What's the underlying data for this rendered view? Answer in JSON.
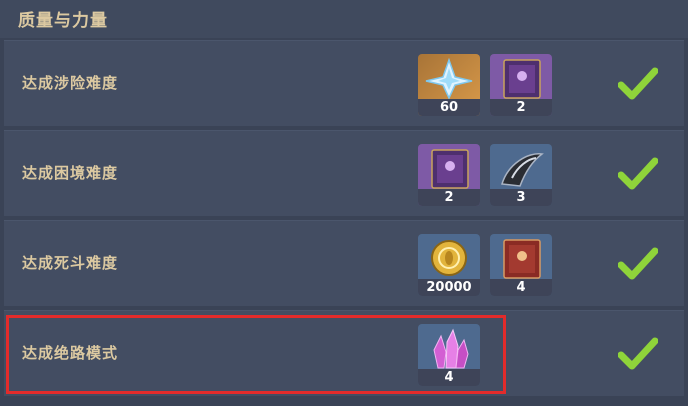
{
  "section": {
    "title": "质量与力量"
  },
  "rows": [
    {
      "label": "达成涉险难度",
      "completed": true,
      "rewards": [
        {
          "icon": "primogem-icon",
          "quantity": "60"
        },
        {
          "icon": "purple-book-icon",
          "quantity": "2"
        }
      ]
    },
    {
      "label": "达成困境难度",
      "completed": true,
      "rewards": [
        {
          "icon": "purple-book-icon",
          "quantity": "2"
        },
        {
          "icon": "horn-material-icon",
          "quantity": "3"
        }
      ]
    },
    {
      "label": "达成死斗难度",
      "completed": true,
      "rewards": [
        {
          "icon": "mora-coin-icon",
          "quantity": "20000"
        },
        {
          "icon": "red-book-icon",
          "quantity": "4"
        }
      ]
    },
    {
      "label": "达成绝路模式",
      "completed": true,
      "highlighted": true,
      "rewards": [
        {
          "icon": "pink-crystal-icon",
          "quantity": "4"
        }
      ]
    }
  ],
  "colors": {
    "accent_check": "#8fd43a",
    "highlight_border": "#e32b2b",
    "label_text": "#dcc9a1"
  }
}
